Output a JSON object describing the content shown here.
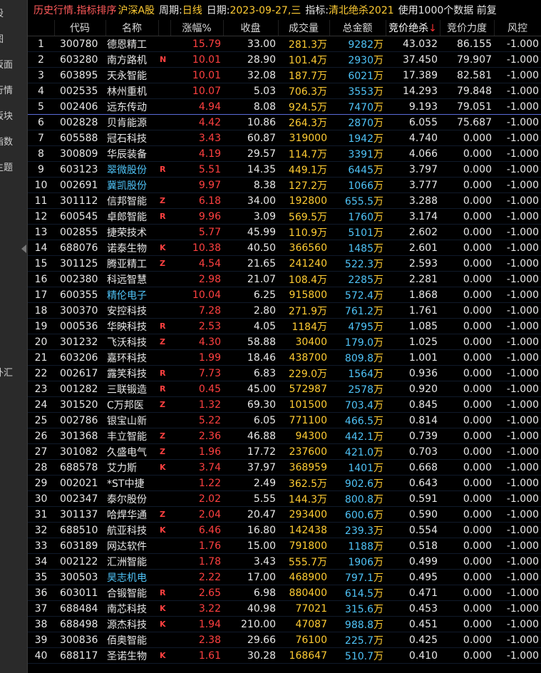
{
  "sidebar": {
    "items": [
      {
        "label": "股"
      },
      {
        "label": "图"
      },
      {
        "label": "板面"
      },
      {
        "label": "行情"
      },
      {
        "label": "板块"
      },
      {
        "label": "指数"
      },
      {
        "label": "主题"
      },
      {
        "label": "外汇"
      }
    ]
  },
  "title": {
    "main": "历史行情.指标排序",
    "market": "沪深A股",
    "period_label": "周期:",
    "period": "日线",
    "date_label": "日期:",
    "date": "2023-09-27,三",
    "indicator_label": "指标:",
    "indicator": "清北绝杀2021",
    "note": "使用1000个数据 前复"
  },
  "columns": [
    "",
    "代码",
    "名称",
    "",
    "涨幅%",
    "收盘",
    "成交量",
    "总金额",
    "竞价绝杀",
    "竞价力度",
    "风控"
  ],
  "sort_arrow": "↓",
  "colors": {
    "up": "#ff4040",
    "yellow": "#ffcc33",
    "cyan": "#4fc3f7",
    "separator": "#5b6bd8"
  },
  "rows": [
    {
      "idx": "1",
      "code": "300780",
      "name": "德恩精工",
      "flag": "",
      "pct": "15.79",
      "close": "33.00",
      "vol": "281.3万",
      "amt": "9282",
      "amt_unit": "万",
      "bid": "43.032",
      "power": "86.155",
      "risk": "-1.000",
      "cyan": false
    },
    {
      "idx": "2",
      "code": "603280",
      "name": "南方路机",
      "flag": "N",
      "pct": "10.01",
      "close": "28.90",
      "vol": "101.4万",
      "amt": "2930",
      "amt_unit": "万",
      "bid": "37.450",
      "power": "79.907",
      "risk": "-1.000",
      "cyan": false
    },
    {
      "idx": "3",
      "code": "603895",
      "name": "天永智能",
      "flag": "",
      "pct": "10.01",
      "close": "32.08",
      "vol": "187.7万",
      "amt": "6021",
      "amt_unit": "万",
      "bid": "17.389",
      "power": "82.581",
      "risk": "-1.000",
      "cyan": false
    },
    {
      "idx": "4",
      "code": "002535",
      "name": "林州重机",
      "flag": "",
      "pct": "10.07",
      "close": "5.03",
      "vol": "706.3万",
      "amt": "3553",
      "amt_unit": "万",
      "bid": "14.293",
      "power": "79.848",
      "risk": "-1.000",
      "cyan": false
    },
    {
      "idx": "5",
      "code": "002406",
      "name": "远东传动",
      "flag": "",
      "pct": "4.94",
      "close": "8.08",
      "vol": "924.5万",
      "amt": "7470",
      "amt_unit": "万",
      "bid": "9.193",
      "power": "79.051",
      "risk": "-1.000",
      "cyan": false
    },
    {
      "idx": "6",
      "code": "002828",
      "name": "贝肯能源",
      "flag": "",
      "pct": "4.42",
      "close": "10.86",
      "vol": "264.3万",
      "amt": "2870",
      "amt_unit": "万",
      "bid": "6.055",
      "power": "75.687",
      "risk": "-1.000",
      "cyan": false
    },
    {
      "idx": "7",
      "code": "605588",
      "name": "冠石科技",
      "flag": "",
      "pct": "3.43",
      "close": "60.87",
      "vol": "319000",
      "amt": "1942",
      "amt_unit": "万",
      "bid": "4.740",
      "power": "0.000",
      "risk": "-1.000",
      "cyan": false
    },
    {
      "idx": "8",
      "code": "300809",
      "name": "华辰装备",
      "flag": "",
      "pct": "4.19",
      "close": "29.57",
      "vol": "114.7万",
      "amt": "3391",
      "amt_unit": "万",
      "bid": "4.066",
      "power": "0.000",
      "risk": "-1.000",
      "cyan": false
    },
    {
      "idx": "9",
      "code": "603123",
      "name": "翠微股份",
      "flag": "R",
      "pct": "5.51",
      "close": "14.35",
      "vol": "449.1万",
      "amt": "6445",
      "amt_unit": "万",
      "bid": "3.797",
      "power": "0.000",
      "risk": "-1.000",
      "cyan": true
    },
    {
      "idx": "10",
      "code": "002691",
      "name": "冀凯股份",
      "flag": "",
      "pct": "9.97",
      "close": "8.38",
      "vol": "127.2万",
      "amt": "1066",
      "amt_unit": "万",
      "bid": "3.777",
      "power": "0.000",
      "risk": "-1.000",
      "cyan": true
    },
    {
      "idx": "11",
      "code": "301112",
      "name": "信邦智能",
      "flag": "Z",
      "pct": "6.18",
      "close": "34.00",
      "vol": "192800",
      "amt": "655.5",
      "amt_unit": "万",
      "bid": "3.288",
      "power": "0.000",
      "risk": "-1.000",
      "cyan": false
    },
    {
      "idx": "12",
      "code": "600545",
      "name": "卓郎智能",
      "flag": "R",
      "pct": "9.96",
      "close": "3.09",
      "vol": "569.5万",
      "amt": "1760",
      "amt_unit": "万",
      "bid": "3.174",
      "power": "0.000",
      "risk": "-1.000",
      "cyan": false
    },
    {
      "idx": "13",
      "code": "002855",
      "name": "捷荣技术",
      "flag": "",
      "pct": "5.77",
      "close": "45.99",
      "vol": "110.9万",
      "amt": "5101",
      "amt_unit": "万",
      "bid": "2.602",
      "power": "0.000",
      "risk": "-1.000",
      "cyan": false
    },
    {
      "idx": "14",
      "code": "688076",
      "name": "诺泰生物",
      "flag": "K",
      "pct": "10.38",
      "close": "40.50",
      "vol": "366560",
      "amt": "1485",
      "amt_unit": "万",
      "bid": "2.601",
      "power": "0.000",
      "risk": "-1.000",
      "cyan": false
    },
    {
      "idx": "15",
      "code": "301125",
      "name": "腾亚精工",
      "flag": "Z",
      "pct": "4.54",
      "close": "21.65",
      "vol": "241240",
      "amt": "522.3",
      "amt_unit": "万",
      "bid": "2.593",
      "power": "0.000",
      "risk": "-1.000",
      "cyan": false
    },
    {
      "idx": "16",
      "code": "002380",
      "name": "科远智慧",
      "flag": "",
      "pct": "2.98",
      "close": "21.07",
      "vol": "108.4万",
      "amt": "2285",
      "amt_unit": "万",
      "bid": "2.281",
      "power": "0.000",
      "risk": "-1.000",
      "cyan": false
    },
    {
      "idx": "17",
      "code": "600355",
      "name": "精伦电子",
      "flag": "",
      "pct": "10.04",
      "close": "6.25",
      "vol": "915800",
      "amt": "572.4",
      "amt_unit": "万",
      "bid": "1.868",
      "power": "0.000",
      "risk": "-1.000",
      "cyan": true
    },
    {
      "idx": "18",
      "code": "300370",
      "name": "安控科技",
      "flag": "",
      "pct": "7.28",
      "close": "2.80",
      "vol": "271.9万",
      "amt": "761.2",
      "amt_unit": "万",
      "bid": "1.761",
      "power": "0.000",
      "risk": "-1.000",
      "cyan": false
    },
    {
      "idx": "19",
      "code": "000536",
      "name": "华映科技",
      "flag": "R",
      "pct": "2.53",
      "close": "4.05",
      "vol": "1184万",
      "amt": "4795",
      "amt_unit": "万",
      "bid": "1.085",
      "power": "0.000",
      "risk": "-1.000",
      "cyan": false
    },
    {
      "idx": "20",
      "code": "301232",
      "name": "飞沃科技",
      "flag": "Z",
      "pct": "4.30",
      "close": "58.88",
      "vol": "30400",
      "amt": "179.0",
      "amt_unit": "万",
      "bid": "1.025",
      "power": "0.000",
      "risk": "-1.000",
      "cyan": false
    },
    {
      "idx": "21",
      "code": "603206",
      "name": "嘉环科技",
      "flag": "",
      "pct": "1.99",
      "close": "18.46",
      "vol": "438700",
      "amt": "809.8",
      "amt_unit": "万",
      "bid": "1.001",
      "power": "0.000",
      "risk": "-1.000",
      "cyan": false
    },
    {
      "idx": "22",
      "code": "002617",
      "name": "露笑科技",
      "flag": "R",
      "pct": "7.73",
      "close": "6.83",
      "vol": "229.0万",
      "amt": "1564",
      "amt_unit": "万",
      "bid": "0.936",
      "power": "0.000",
      "risk": "-1.000",
      "cyan": false
    },
    {
      "idx": "23",
      "code": "001282",
      "name": "三联锻造",
      "flag": "R",
      "pct": "0.45",
      "close": "45.00",
      "vol": "572987",
      "amt": "2578",
      "amt_unit": "万",
      "bid": "0.920",
      "power": "0.000",
      "risk": "-1.000",
      "cyan": false
    },
    {
      "idx": "24",
      "code": "301520",
      "name": "C万邦医",
      "flag": "Z",
      "pct": "1.32",
      "close": "69.30",
      "vol": "101500",
      "amt": "703.4",
      "amt_unit": "万",
      "bid": "0.845",
      "power": "0.000",
      "risk": "-1.000",
      "cyan": false
    },
    {
      "idx": "25",
      "code": "002786",
      "name": "银宝山新",
      "flag": "",
      "pct": "5.22",
      "close": "6.05",
      "vol": "771100",
      "amt": "466.5",
      "amt_unit": "万",
      "bid": "0.814",
      "power": "0.000",
      "risk": "-1.000",
      "cyan": false
    },
    {
      "idx": "26",
      "code": "301368",
      "name": "丰立智能",
      "flag": "Z",
      "pct": "2.36",
      "close": "46.88",
      "vol": "94300",
      "amt": "442.1",
      "amt_unit": "万",
      "bid": "0.739",
      "power": "0.000",
      "risk": "-1.000",
      "cyan": false
    },
    {
      "idx": "27",
      "code": "301082",
      "name": "久盛电气",
      "flag": "Z",
      "pct": "1.96",
      "close": "17.72",
      "vol": "237600",
      "amt": "421.0",
      "amt_unit": "万",
      "bid": "0.703",
      "power": "0.000",
      "risk": "-1.000",
      "cyan": false
    },
    {
      "idx": "28",
      "code": "688578",
      "name": "艾力斯",
      "flag": "K",
      "pct": "3.74",
      "close": "37.97",
      "vol": "368959",
      "amt": "1401",
      "amt_unit": "万",
      "bid": "0.668",
      "power": "0.000",
      "risk": "-1.000",
      "cyan": false
    },
    {
      "idx": "29",
      "code": "002021",
      "name": "*ST中捷",
      "flag": "",
      "pct": "1.22",
      "close": "2.49",
      "vol": "362.5万",
      "amt": "902.6",
      "amt_unit": "万",
      "bid": "0.643",
      "power": "0.000",
      "risk": "-1.000",
      "cyan": false
    },
    {
      "idx": "30",
      "code": "002347",
      "name": "泰尔股份",
      "flag": "",
      "pct": "2.02",
      "close": "5.55",
      "vol": "144.3万",
      "amt": "800.8",
      "amt_unit": "万",
      "bid": "0.591",
      "power": "0.000",
      "risk": "-1.000",
      "cyan": false
    },
    {
      "idx": "31",
      "code": "301137",
      "name": "哈焊华通",
      "flag": "Z",
      "pct": "2.04",
      "close": "20.47",
      "vol": "293400",
      "amt": "600.6",
      "amt_unit": "万",
      "bid": "0.590",
      "power": "0.000",
      "risk": "-1.000",
      "cyan": false
    },
    {
      "idx": "32",
      "code": "688510",
      "name": "航亚科技",
      "flag": "K",
      "pct": "6.46",
      "close": "16.80",
      "vol": "142438",
      "amt": "239.3",
      "amt_unit": "万",
      "bid": "0.554",
      "power": "0.000",
      "risk": "-1.000",
      "cyan": false
    },
    {
      "idx": "33",
      "code": "603189",
      "name": "网达软件",
      "flag": "",
      "pct": "1.76",
      "close": "15.00",
      "vol": "791800",
      "amt": "1188",
      "amt_unit": "万",
      "bid": "0.518",
      "power": "0.000",
      "risk": "-1.000",
      "cyan": false
    },
    {
      "idx": "34",
      "code": "002122",
      "name": "汇洲智能",
      "flag": "",
      "pct": "1.78",
      "close": "3.43",
      "vol": "555.7万",
      "amt": "1906",
      "amt_unit": "万",
      "bid": "0.499",
      "power": "0.000",
      "risk": "-1.000",
      "cyan": false
    },
    {
      "idx": "35",
      "code": "300503",
      "name": "昊志机电",
      "flag": "",
      "pct": "2.22",
      "close": "17.00",
      "vol": "468900",
      "amt": "797.1",
      "amt_unit": "万",
      "bid": "0.495",
      "power": "0.000",
      "risk": "-1.000",
      "cyan": true
    },
    {
      "idx": "36",
      "code": "603011",
      "name": "合锻智能",
      "flag": "R",
      "pct": "2.65",
      "close": "6.98",
      "vol": "880400",
      "amt": "614.5",
      "amt_unit": "万",
      "bid": "0.471",
      "power": "0.000",
      "risk": "-1.000",
      "cyan": false
    },
    {
      "idx": "37",
      "code": "688484",
      "name": "南芯科技",
      "flag": "K",
      "pct": "3.22",
      "close": "40.98",
      "vol": "77021",
      "amt": "315.6",
      "amt_unit": "万",
      "bid": "0.453",
      "power": "0.000",
      "risk": "-1.000",
      "cyan": false
    },
    {
      "idx": "38",
      "code": "688498",
      "name": "源杰科技",
      "flag": "K",
      "pct": "1.94",
      "close": "210.00",
      "vol": "47087",
      "amt": "988.8",
      "amt_unit": "万",
      "bid": "0.451",
      "power": "0.000",
      "risk": "-1.000",
      "cyan": false
    },
    {
      "idx": "39",
      "code": "300836",
      "name": "佰奥智能",
      "flag": "",
      "pct": "2.38",
      "close": "29.66",
      "vol": "76100",
      "amt": "225.7",
      "amt_unit": "万",
      "bid": "0.425",
      "power": "0.000",
      "risk": "-1.000",
      "cyan": false
    },
    {
      "idx": "40",
      "code": "688117",
      "name": "圣诺生物",
      "flag": "K",
      "pct": "1.61",
      "close": "30.28",
      "vol": "168647",
      "amt": "510.7",
      "amt_unit": "万",
      "bid": "0.410",
      "power": "0.000",
      "risk": "-1.000",
      "cyan": false
    }
  ]
}
